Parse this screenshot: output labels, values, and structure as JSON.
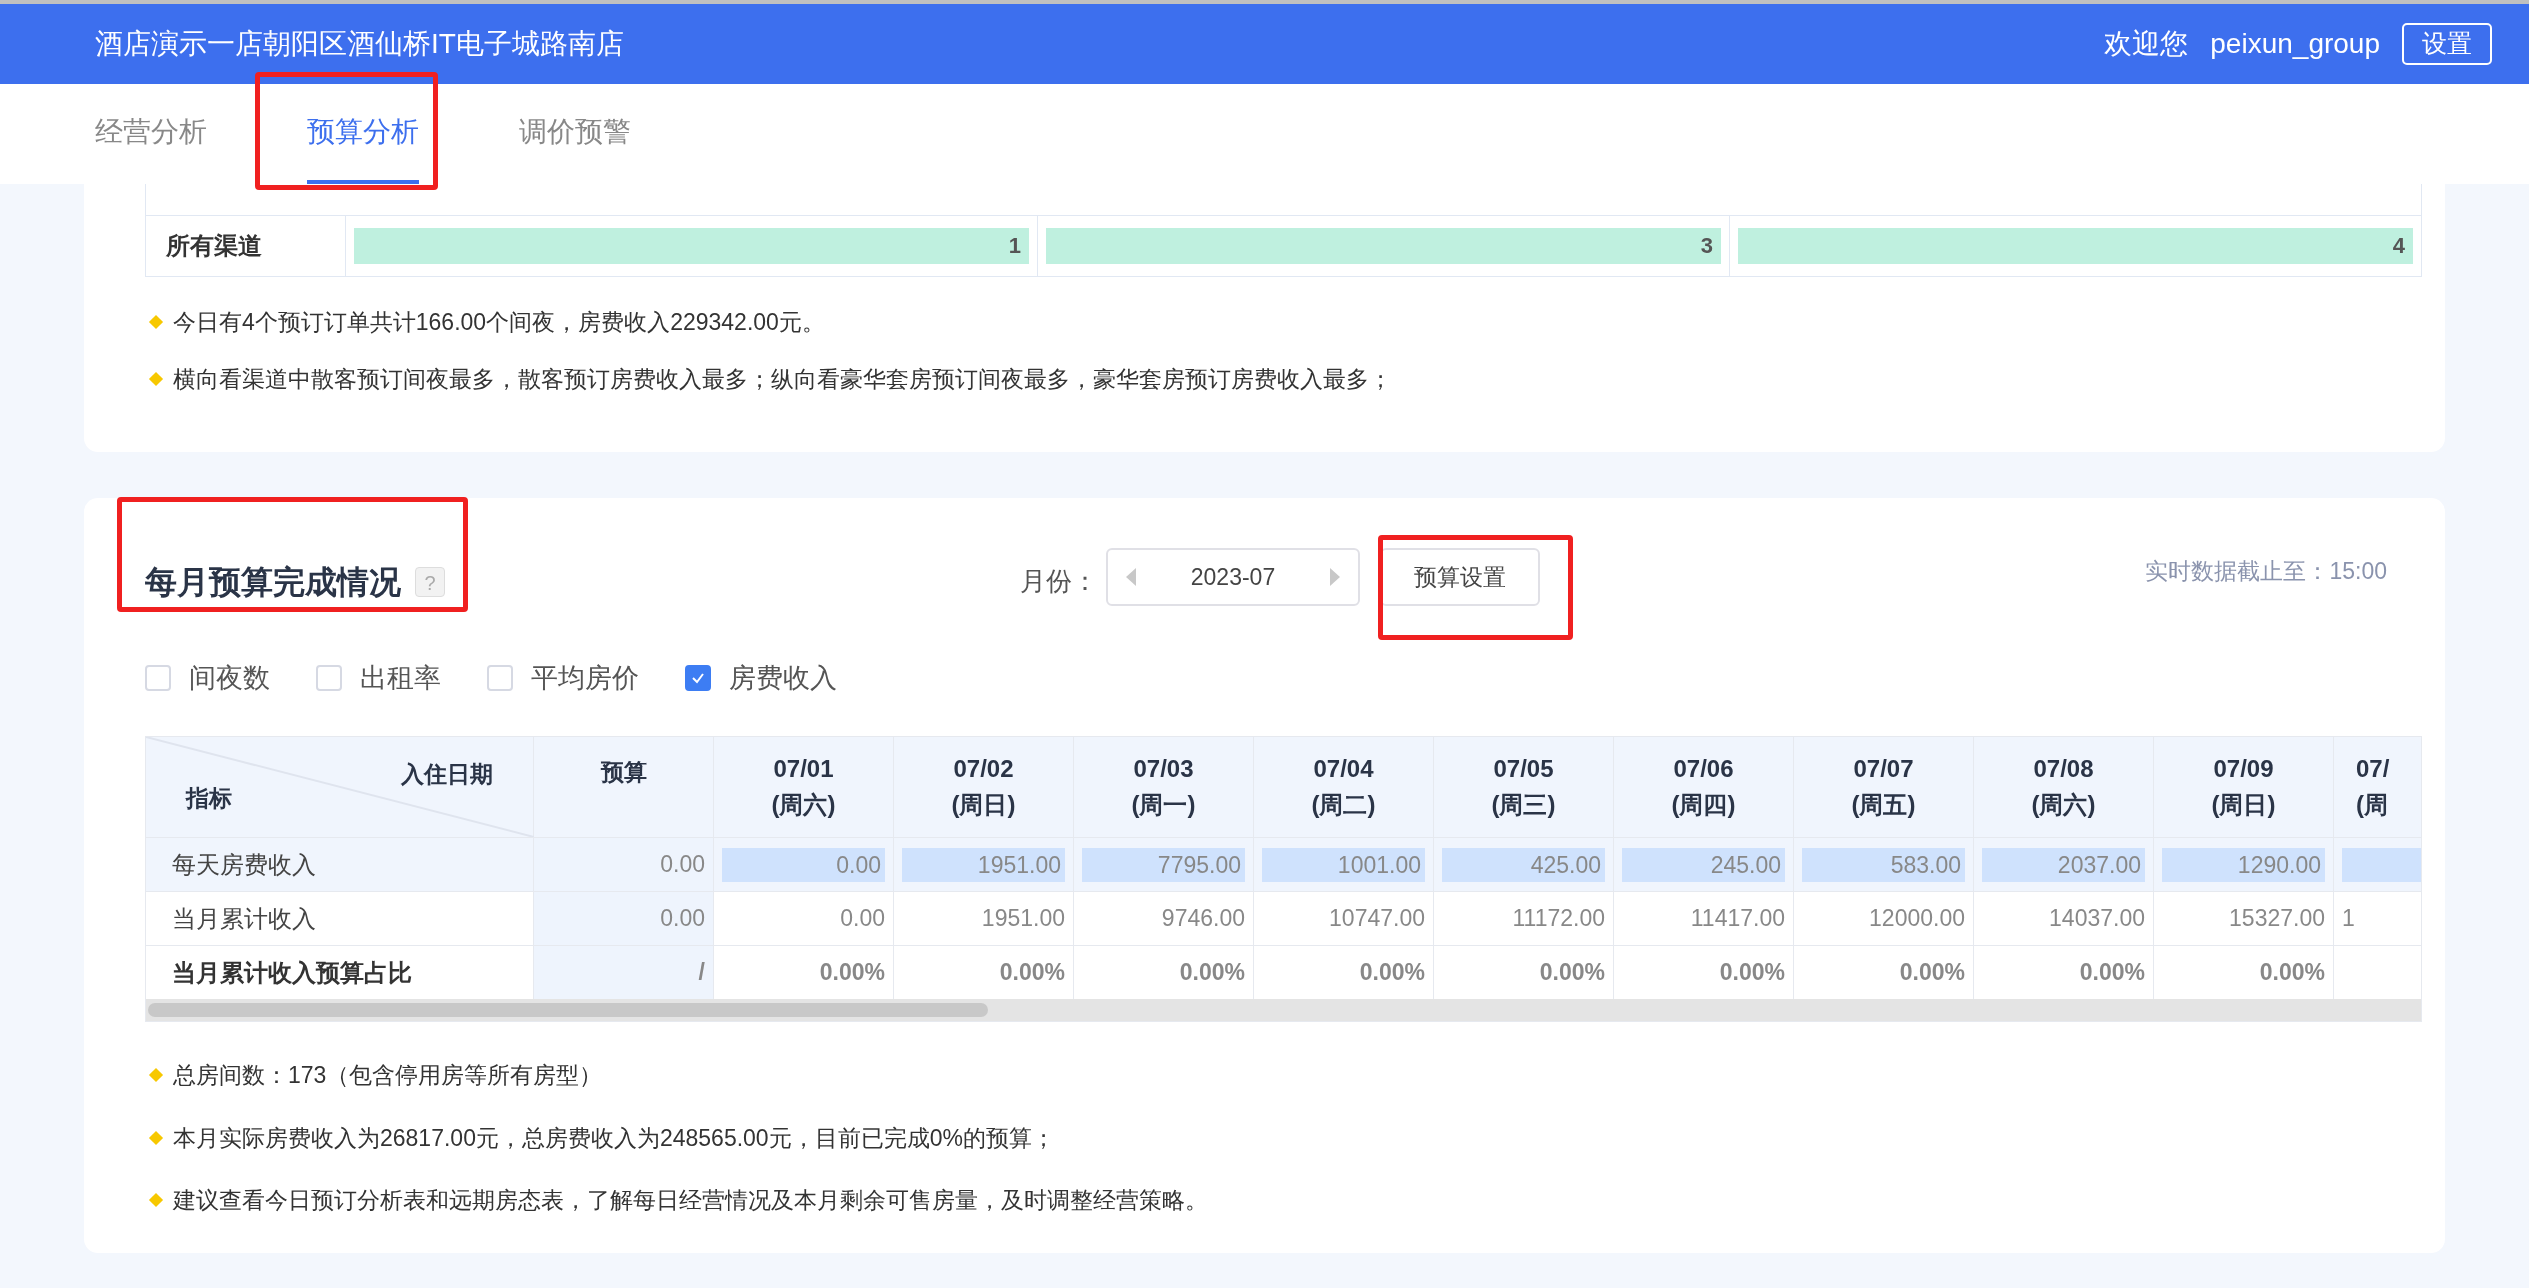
{
  "header": {
    "title": "酒店演示一店朝阳区酒仙桥IT电子城路南店",
    "welcome": "欢迎您",
    "username": "peixun_group",
    "settings_button": "设置"
  },
  "tabs": [
    {
      "label": "经营分析",
      "selected": false
    },
    {
      "label": "预算分析",
      "selected": true
    },
    {
      "label": "调价预警",
      "selected": false
    }
  ],
  "channel_table": {
    "rows": [
      {
        "label": "所有渠道",
        "values": [
          "1",
          "3",
          "4"
        ]
      }
    ]
  },
  "channel_notes": [
    "今日有4个预订订单共计166.00个间夜，房费收入229342.00元。",
    "横向看渠道中散客预订间夜最多，散客预订房费收入最多；纵向看豪华套房预订间夜最多，豪华套房预订房费收入最多；"
  ],
  "budget_section": {
    "title": "每月预算完成情况",
    "help": "?",
    "month_label": "月份：",
    "month_value": "2023-07",
    "budget_button": "预算设置",
    "realtime": "实时数据截止至：15:00",
    "filters": [
      {
        "label": "间夜数",
        "checked": false
      },
      {
        "label": "出租率",
        "checked": false
      },
      {
        "label": "平均房价",
        "checked": false
      },
      {
        "label": "房费收入",
        "checked": true
      }
    ],
    "table": {
      "corner_top": "入住日期",
      "corner_bottom": "指标",
      "budget_header": "预算",
      "columns": [
        {
          "date": "07/01",
          "weekday": "(周六)"
        },
        {
          "date": "07/02",
          "weekday": "(周日)"
        },
        {
          "date": "07/03",
          "weekday": "(周一)"
        },
        {
          "date": "07/04",
          "weekday": "(周二)"
        },
        {
          "date": "07/05",
          "weekday": "(周三)"
        },
        {
          "date": "07/06",
          "weekday": "(周四)"
        },
        {
          "date": "07/07",
          "weekday": "(周五)"
        },
        {
          "date": "07/08",
          "weekday": "(周六)"
        },
        {
          "date": "07/09",
          "weekday": "(周日)"
        },
        {
          "date": "07/",
          "weekday": "(周"
        }
      ],
      "rows": [
        {
          "kind": "bar",
          "label": "每天房费收入",
          "budget": "0.00",
          "cells": [
            "0.00",
            "1951.00",
            "7795.00",
            "1001.00",
            "425.00",
            "245.00",
            "583.00",
            "2037.00",
            "1290.00"
          ]
        },
        {
          "kind": "plain",
          "label": "当月累计收入",
          "budget": "0.00",
          "cells": [
            "0.00",
            "1951.00",
            "9746.00",
            "10747.00",
            "11172.00",
            "11417.00",
            "12000.00",
            "14037.00",
            "15327.00",
            "1"
          ]
        },
        {
          "kind": "ratio",
          "label": "当月累计收入预算占比",
          "budget": "/",
          "cells": [
            "0.00%",
            "0.00%",
            "0.00%",
            "0.00%",
            "0.00%",
            "0.00%",
            "0.00%",
            "0.00%",
            "0.00%"
          ]
        }
      ]
    },
    "notes": [
      "总房间数：173（包含停用房等所有房型）",
      "本月实际房费收入为26817.00元，总房费收入为248565.00元，目前已完成0%的预算；",
      "建议查看今日预订分析表和远期房态表，了解每日经营情况及本月剩余可售房量，及时调整经营策略。"
    ]
  }
}
